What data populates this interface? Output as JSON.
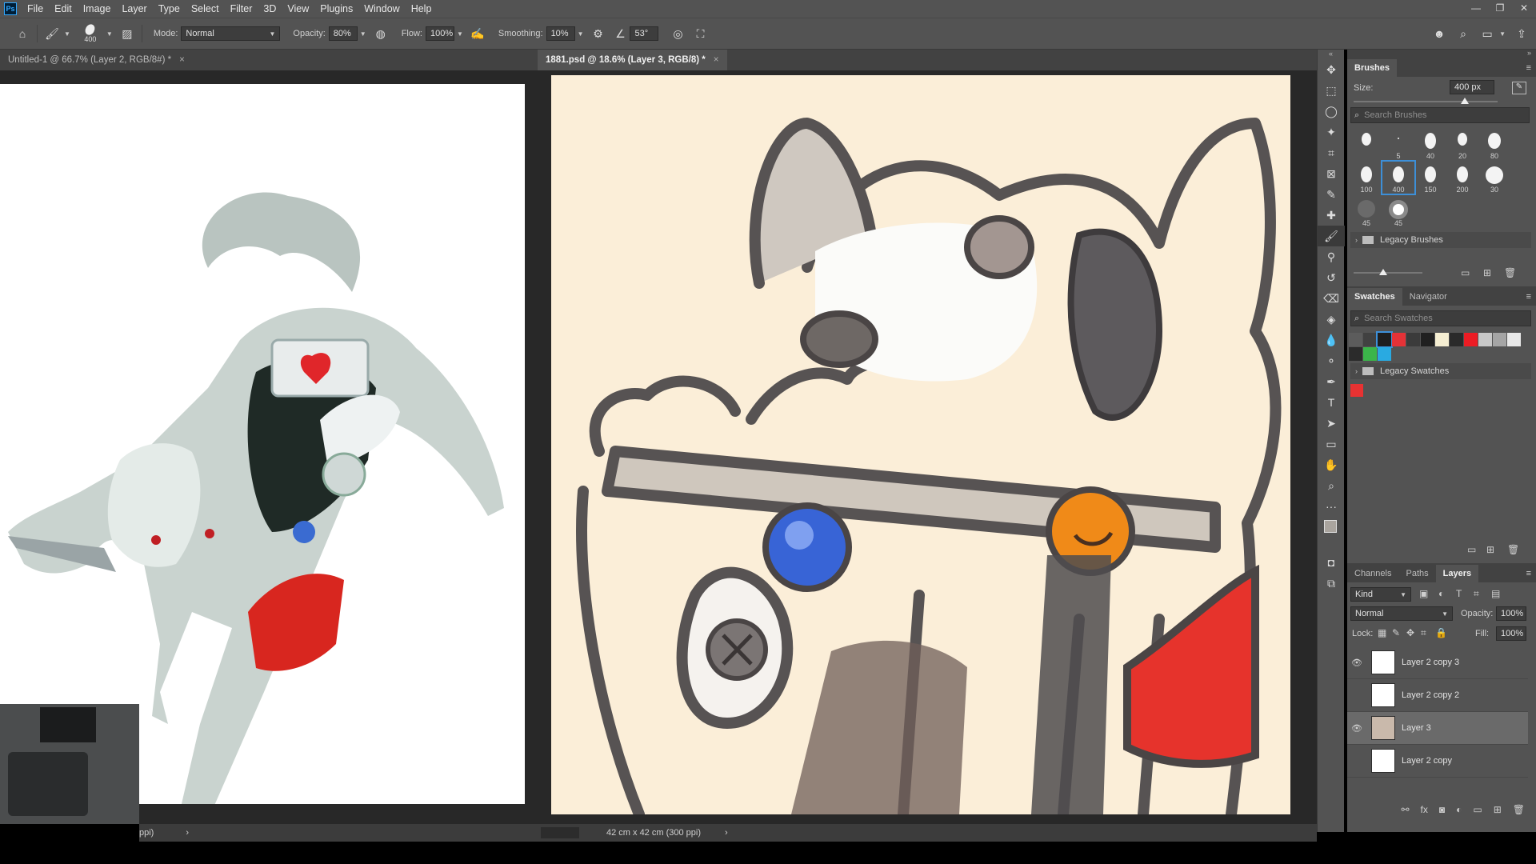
{
  "app": {
    "logo": "Ps"
  },
  "menu": [
    "File",
    "Edit",
    "Image",
    "Layer",
    "Type",
    "Select",
    "Filter",
    "3D",
    "View",
    "Plugins",
    "Window",
    "Help"
  ],
  "window_controls": {
    "minimize": "—",
    "restore": "❐",
    "close": "✕"
  },
  "options": {
    "brush_size": "400",
    "mode_label": "Mode:",
    "mode_value": "Normal",
    "opacity_label": "Opacity:",
    "opacity_value": "80%",
    "flow_label": "Flow:",
    "flow_value": "100%",
    "smoothing_label": "Smoothing:",
    "smoothing_value": "10%",
    "angle_value": "53°"
  },
  "docs": {
    "left_tab": "Untitled-1 @ 66.7% (Layer 2, RGB/8#) *",
    "right_tab": "1881.psd @ 18.6% (Layer 3, RGB/8) *",
    "left_status": "ppi)",
    "right_status": "42 cm x 42 cm (300 ppi)"
  },
  "brushes": {
    "tab": "Brushes",
    "size_label": "Size:",
    "size_value": "400 px",
    "search_placeholder": "Search Brushes",
    "sizes_row1": [
      "",
      "5",
      "40",
      "20",
      "80"
    ],
    "sizes_row2": [
      "100",
      "400",
      "150",
      "200",
      "30"
    ],
    "sizes_row3": [
      "45",
      "45"
    ],
    "group": "Legacy Brushes"
  },
  "swatches": {
    "tabs": [
      "Swatches",
      "Navigator"
    ],
    "search_placeholder": "Search Swatches",
    "row1": [
      "#5c5c5c",
      "#414141",
      "#1e1e1e",
      "#e53237",
      "#3b3b3b",
      "#202020",
      "#f5eed2",
      "#2a2a2a",
      "#ec1c24",
      "#c8c8c8",
      "#a5a5a5",
      "#e8e8e8"
    ],
    "row2": [
      "#2b2b2b",
      "#3bb54a",
      "#29aae1"
    ],
    "group": "Legacy Swatches",
    "recent": "#e83232"
  },
  "layers": {
    "tabs": [
      "Channels",
      "Paths",
      "Layers"
    ],
    "kind_label": "Kind",
    "blend": "Normal",
    "opacity_label": "Opacity:",
    "opacity_value": "100%",
    "lock_label": "Lock:",
    "fill_label": "Fill:",
    "fill_value": "100%",
    "items": [
      {
        "name": "Layer 2 copy 3",
        "visible": true
      },
      {
        "name": "Layer 2 copy 2",
        "visible": false
      },
      {
        "name": "Layer 3",
        "visible": true
      },
      {
        "name": "Layer 2 copy",
        "visible": false
      }
    ]
  }
}
